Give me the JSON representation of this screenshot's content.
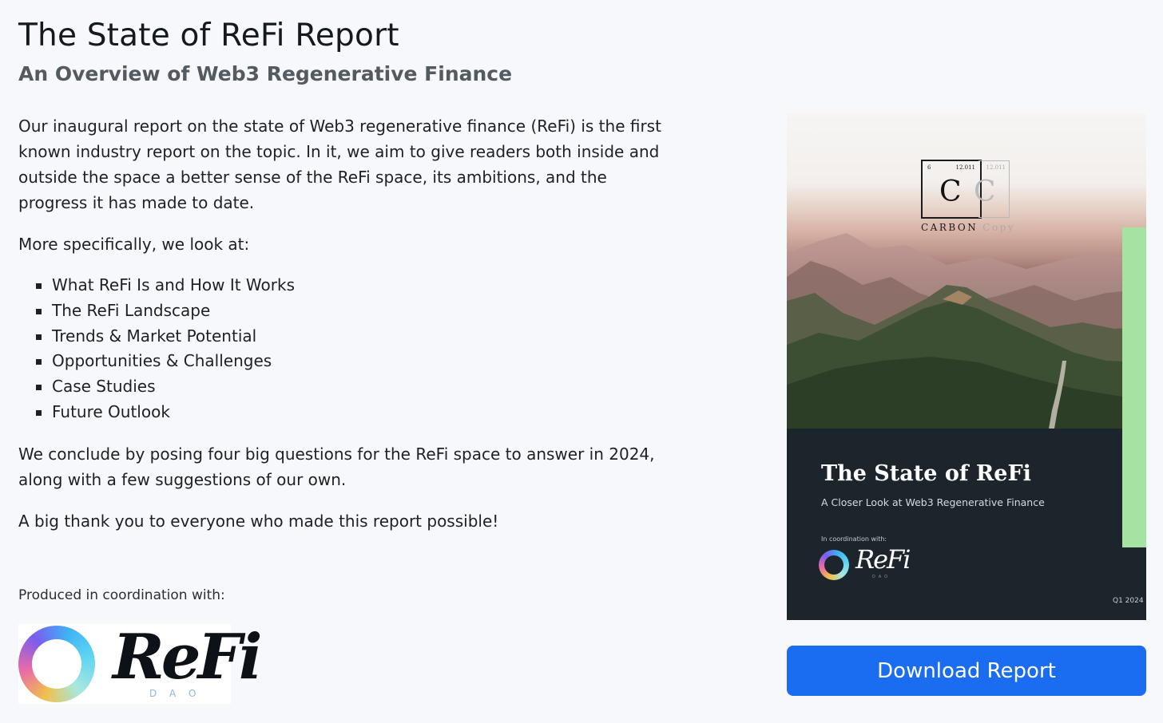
{
  "header": {
    "title": "The State of ReFi Report",
    "subtitle": "An Overview of Web3 Regenerative Finance"
  },
  "intro": {
    "paragraph1": "Our inaugural report on the state of Web3 regenerative finance (ReFi) is the first known industry report on the topic. In it, we aim to give readers both inside and outside the space a better sense of the ReFi space, its ambitions, and the progress it has made to date.",
    "paragraph2": "More specifically, we look at:",
    "topics": [
      "What ReFi Is and How It Works",
      "The ReFi Landscape",
      "Trends & Market Potential",
      "Opportunities & Challenges",
      "Case Studies",
      "Future Outlook"
    ],
    "paragraph3": "We conclude by posing four big questions for the ReFi space to answer in 2024, along with a few suggestions of our own.",
    "paragraph4": "A big thank you to everyone who made this report possible!"
  },
  "coordination": {
    "label": "Produced in coordination with:",
    "logo_word": "ReFi",
    "logo_sub": "DAO"
  },
  "cover": {
    "element_number": "6",
    "element_mass": "12.011",
    "element_mass_ghost": "12.011",
    "element_letter": "C",
    "element_letter_ghost": "C",
    "brand_main": "CARBON",
    "brand_ghost": "Copy",
    "title": "The State of ReFi",
    "subtitle": "A Closer Look at Web3 Regenerative Finance",
    "coord_label": "In coordination with:",
    "logo_word": "ReFi",
    "logo_sub": "DAO",
    "date": "Q1 2024"
  },
  "actions": {
    "download_label": "Download Report"
  },
  "colors": {
    "accent": "#1a6cf0",
    "cover_dark": "#1d252c",
    "cover_green": "#a6e3a2"
  }
}
